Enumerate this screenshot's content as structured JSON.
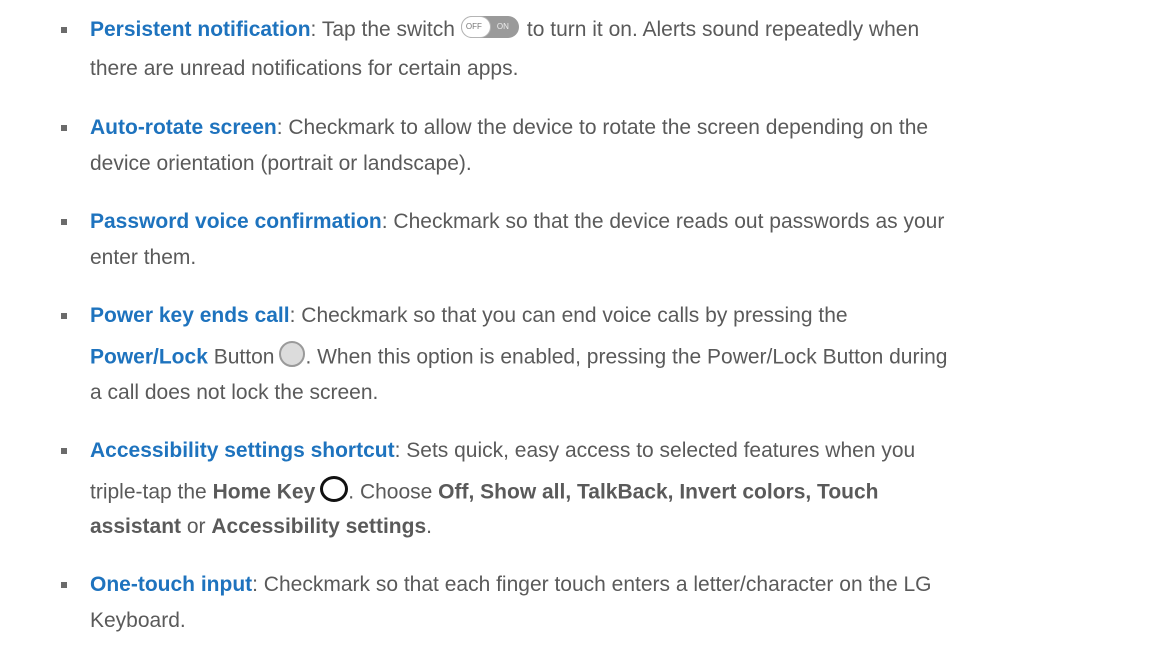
{
  "items": [
    {
      "term": "Persistent notification",
      "text_a": ": Tap the switch",
      "switch_off": "OFF",
      "switch_on": "ON",
      "text_b": "to turn it on. Alerts sound repeatedly when",
      "line2": "there are unread notifications for certain apps."
    },
    {
      "term": "Auto-rotate screen",
      "text_a": ": Checkmark to allow the device to rotate the screen depending on the",
      "line2": "device orientation (portrait or landscape)."
    },
    {
      "term": "Password voice confirmation",
      "text_a": ": Checkmark so that the device reads out passwords as your",
      "line2": "enter them."
    },
    {
      "term": "Power key ends call",
      "text_a": ": Checkmark so that you can end voice calls by pressing the",
      "bold_b": "Power/Lock",
      "text_b": " Button",
      "text_c": ". When this option is enabled, pressing the Power/Lock Button during",
      "line3": "a call does not lock the screen."
    },
    {
      "term": "Accessibility settings shortcut",
      "text_a": ": Sets quick, easy access to selected features when you",
      "text_b1": "triple-tap the ",
      "bold_b1": "Home Key",
      "text_b2": ". Choose ",
      "bold_b2": "Off, Show all, TalkBack, Invert colors, Touch",
      "bold_c1": "assistant",
      "text_c1": " or ",
      "bold_c2": "Accessibility settings",
      "text_c2": "."
    },
    {
      "term": "One-touch input",
      "text_a": ": Checkmark so that each finger touch enters a letter/character on the LG",
      "line2": "Keyboard."
    }
  ]
}
